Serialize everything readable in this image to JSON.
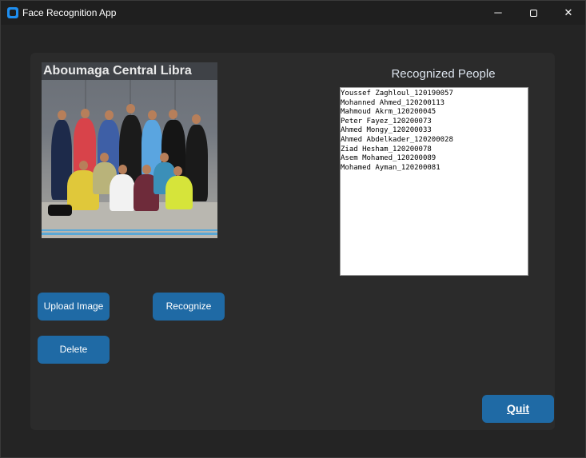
{
  "window": {
    "title": "Face Recognition App",
    "minimize_glyph": "─",
    "close_glyph": "✕"
  },
  "photo": {
    "sign_text": "Aboumaga Central Libra"
  },
  "buttons": {
    "upload": "Upload Image",
    "recognize": "Recognize",
    "delete": "Delete",
    "quit": "Quit"
  },
  "results": {
    "heading": "Recognized People",
    "items": [
      "Youssef Zaghloul_120190057",
      "Mohanned Ahmed_120200113",
      "Mahmoud Akrm_120200045",
      "Peter Fayez_120200073",
      "Ahmed Mongy_120200033",
      "Ahmed Abdelkader_120200028",
      "Ziad Hesham_120200078",
      "Asem Mohamed_120200089",
      "Mohamed Ayman_120200081"
    ]
  },
  "colors": {
    "button": "#1f6aa5",
    "panel": "#2b2b2b",
    "window": "#242424",
    "app_icon": "#1e8ef0"
  }
}
